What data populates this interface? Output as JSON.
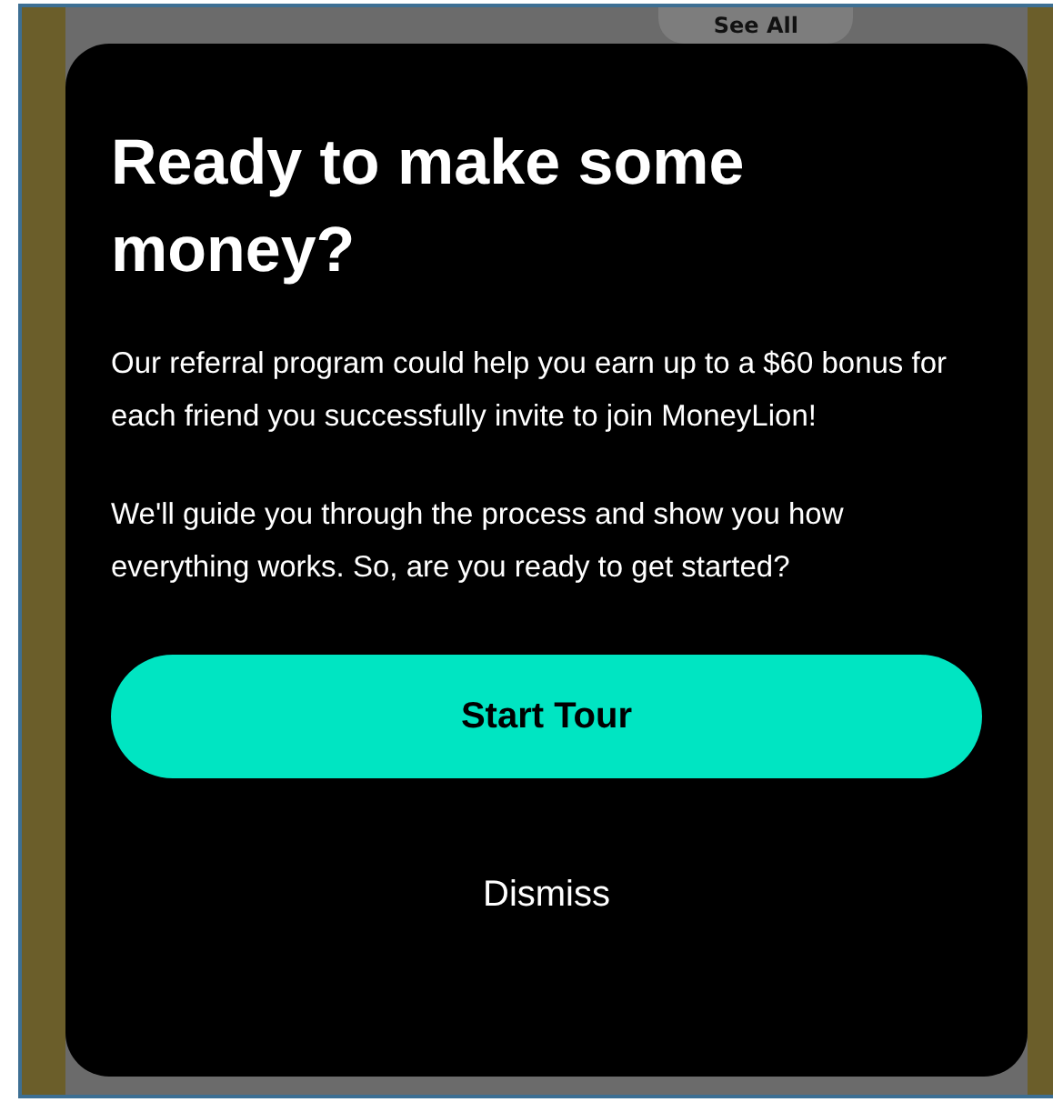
{
  "background": {
    "link": "See All"
  },
  "modal": {
    "title": "Ready to make some money?",
    "paragraphs": [
      "Our referral program could help you earn up to a $60 bonus for each friend you successfully invite to join MoneyLion!",
      "We'll guide you through the process and show you how everything works. So, are you ready to get started?"
    ],
    "buttons": [
      {
        "label": "Start Tour",
        "kind": "primary"
      },
      {
        "label": "Dismiss",
        "kind": "text"
      }
    ]
  }
}
